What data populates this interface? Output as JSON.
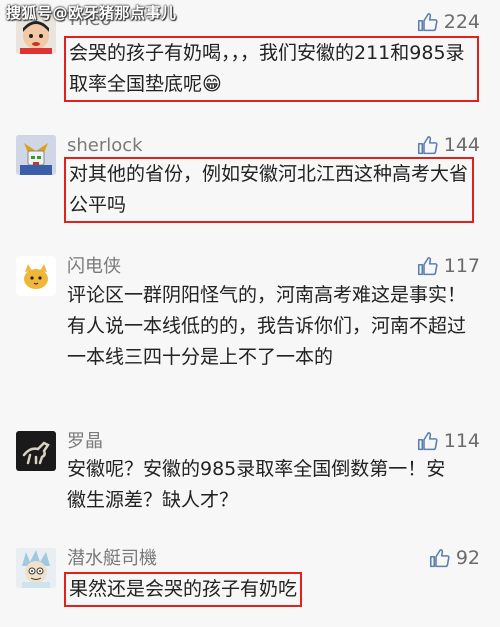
{
  "watermark": "搜狐号@欧牙猪那点事儿",
  "comments": [
    {
      "name": "Theo",
      "likes": "224",
      "text": "会哭的孩子有奶喝，，，我们安徽的211和985录取率全国垫底呢😁",
      "highlighted": true,
      "avatar_icon": "cartoon-boy-avatar-icon"
    },
    {
      "name": "sherlock",
      "likes": "144",
      "text": "对其他的省份，例如安徽河北江西这种高考大省公平吗",
      "highlighted": true,
      "avatar_icon": "robot-avatar-icon"
    },
    {
      "name": "闪电侠",
      "likes": "117",
      "text": "评论区一群阴阳怪气的，河南高考难这是事实！有人说一本线低的的，我告诉你们，河南不超过一本线三四十分是上不了一本的",
      "highlighted": false,
      "avatar_icon": "cat-avatar-icon"
    },
    {
      "name": "罗晶",
      "likes": "114",
      "text": "安徽呢？安徽的985录取率全国倒数第一！安徽生源差？缺人才？",
      "highlighted": false,
      "avatar_icon": "horse-statue-avatar-icon"
    },
    {
      "name": "潜水艇司機",
      "likes": "92",
      "text": "果然还是会哭的孩子有奶吃",
      "highlighted": true,
      "avatar_icon": "rick-avatar-icon"
    }
  ],
  "colors": {
    "highlight_border": "#e0221c",
    "background": "#f7f7f7",
    "name": "#7a7a7a",
    "text": "#222222"
  }
}
